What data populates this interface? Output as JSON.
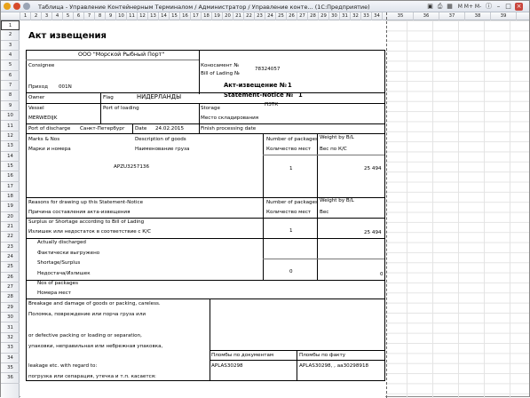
{
  "window": {
    "title": "Таблица - Управление Контейнерным Терминалом / Администратор / Управление конте... (1С:Предприятие)",
    "toolbar_right": "М М+ М-"
  },
  "columns": [
    "1",
    "2",
    "3",
    "4",
    "5",
    "6",
    "7",
    "8",
    "9",
    "10",
    "11",
    "12",
    "13",
    "14",
    "15",
    "16",
    "17",
    "18",
    "19",
    "20",
    "21",
    "22",
    "23",
    "24",
    "25",
    "26",
    "27",
    "28",
    "29",
    "30",
    "31",
    "32",
    "33",
    "34",
    "35",
    "36",
    "37",
    "38",
    "39"
  ],
  "rows": [
    "1",
    "2",
    "3",
    "4",
    "5",
    "6",
    "7",
    "8",
    "9",
    "10",
    "11",
    "12",
    "13",
    "14",
    "15",
    "16",
    "17",
    "18",
    "19",
    "20",
    "21",
    "22",
    "23",
    "24",
    "25",
    "26",
    "27",
    "28",
    "29",
    "30",
    "31",
    "32",
    "33",
    "34",
    "35",
    "36"
  ],
  "doc": {
    "title": "Акт извещения",
    "company": "ООО \"Морской Рыбный Порт\"",
    "consignee": "Consignee",
    "bol_label": "Коносамент №",
    "bol_label_en": "Bill of Lading №",
    "bol_number": "78324057",
    "arrival_label": "Приход",
    "arrival_value": "001N",
    "act_ru": "Акт-извещение №",
    "act_ru_num": "1",
    "act_en": "Statement-Notice №",
    "act_en_num": "1",
    "owner": "Owner",
    "flag": "Flag",
    "flag_value": "НИДЕРЛАНДЫ",
    "vessel": "Vessel",
    "port_loading": "Port of loading",
    "storage": "Storage",
    "storage_value": "ПЗТК",
    "vessel_value": "MERWEDIJK",
    "storage_place": "Место складирования",
    "port_discharge": "Port of discharge",
    "port_discharge_value": "Санкт-Петербург",
    "date_label": "Date",
    "date_value": "24.02.2015",
    "finish_date": "Finish processing date",
    "marks_en": "Marks & Nos",
    "marks_ru": "Марки и номера",
    "descr_en": "Description of goods",
    "descr_ru": "Наименование груза",
    "pkg_en": "Number of packages",
    "pkg_ru": "Количество мест",
    "weight_en": "Weight by B/L",
    "weight_ru": "Вес по К/С",
    "container": "APZU3257136",
    "packages_1": "1",
    "weight_1": "25 494",
    "reasons_en": "Reasons for drawing up this Statement-Notice",
    "reasons_ru": "Причина составления акта-извещения",
    "pkg_en2": "Number of packages",
    "pkg_ru2": "Количество мест",
    "weight_en2": "Weight by B/L",
    "weight_ru2": "Вес",
    "surplus_en": "Surplus or Shortage according to Bill of Lading",
    "surplus_ru": "Излишек или недостаток в соответствие с К/С",
    "packages_2": "1",
    "weight_2": "25 494",
    "actually_discharged": "Actually discharged",
    "fact_discharged": "Фактически выгружено",
    "shortage_en": "Shortage/Surplus",
    "shortage_ru": "Недостача/Излишек",
    "packages_3": "0",
    "weight_3": "0",
    "nos_en": "Nos of packages",
    "nos_ru": "Номера мест",
    "breakage_en": "Breakage and damage of goods or packing, careless.",
    "breakage_ru": "Поломка, повреждение или порча груза или",
    "defective_en": "or defective packing or loading or separation,",
    "defective_ru": "упаковки, неправильная или небрежная упаковка,",
    "leakage_en": "leakage etc. with regard to:",
    "leakage_ru": "погрузка или сепарация, утечка и т.п. касается:",
    "seals_docs": "Пломбы по документам",
    "seals_fact": "Пломбы по факту",
    "seal_doc_value": "APLAS30298",
    "seal_fact_value": "APLAS30298, , aa30298918"
  }
}
